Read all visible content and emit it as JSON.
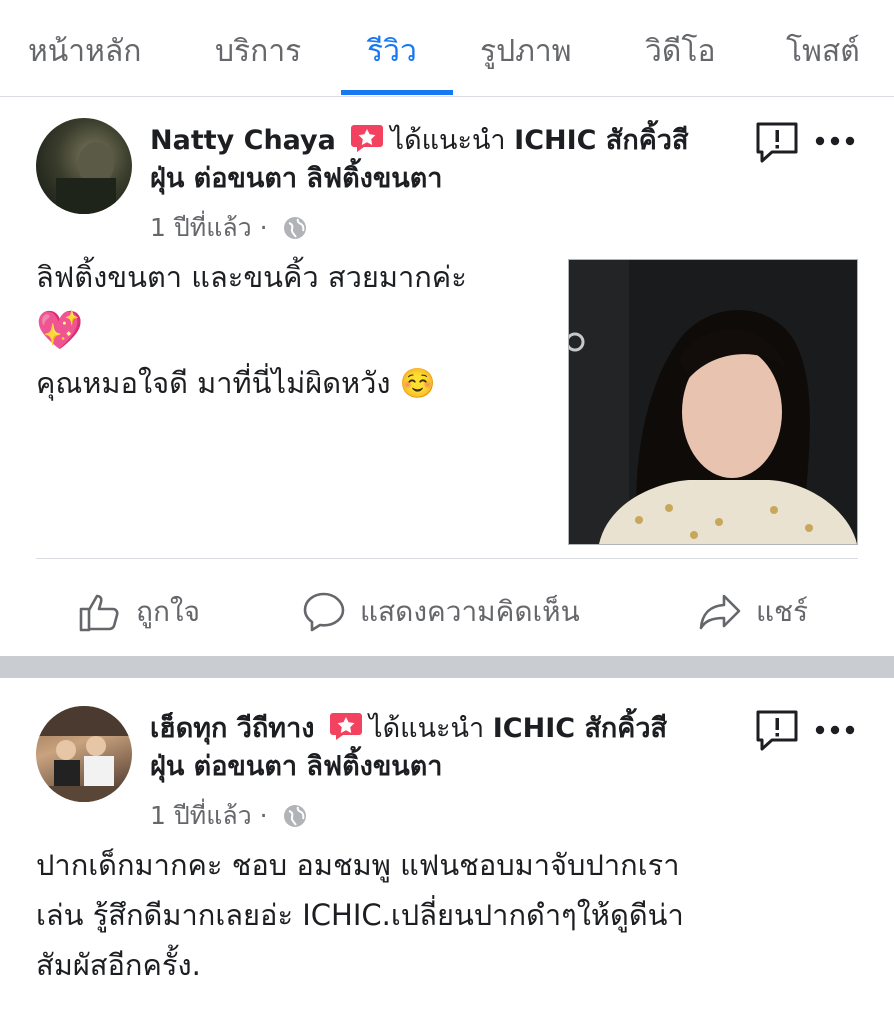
{
  "tabs": [
    {
      "label": "หน้าหลัก"
    },
    {
      "label": "บริการ"
    },
    {
      "label": "รีวิว"
    },
    {
      "label": "รูปภาพ"
    },
    {
      "label": "วิดีโอ"
    },
    {
      "label": "โพสต์"
    }
  ],
  "active_tab": "รีวิว",
  "reviews": [
    {
      "author": "Natty Chaya",
      "recommend_text": "ได้แนะนำ",
      "page_name_line1": "ICHIC สักคิ้วสี",
      "page_name_line2": "ฝุ่น ต่อขนตา ลิฟติ้งขนตา",
      "time": "1 ปีที่แล้ว ·",
      "body_line1": "ลิฟติ้งขนตา และขนคิ้ว สวยมากค่ะ",
      "body_emoji": "💖",
      "body_line3": "คุณหมอใจดี มาที่นี่ไม่ผิดหวัง ☺️"
    },
    {
      "author": "เฮ็ดทุก วีถีทาง",
      "recommend_text": "ได้แนะนำ",
      "page_name_line1": "ICHIC สักคิ้วสี",
      "page_name_line2": "ฝุ่น ต่อขนตา ลิฟติ้งขนตา",
      "time": "1 ปีที่แล้ว ·",
      "body_line1": "ปากเด็กมากคะ ชอบ อมชมพู แฟนชอบมาจับปากเรา",
      "body_line2": "เล่น รู้สึกดีมากเลยอ่ะ ICHIC.เปลี่ยนปากดำๆให้ดูดีน่า",
      "body_line3": "สัมผัสอีกครั้ง."
    }
  ],
  "actions": {
    "like": "ถูกใจ",
    "comment": "แสดงความคิดเห็น",
    "share": "แชร์"
  },
  "colors": {
    "accent": "#1877f2",
    "recommend_badge": "#f3425f",
    "muted": "#65676b"
  }
}
